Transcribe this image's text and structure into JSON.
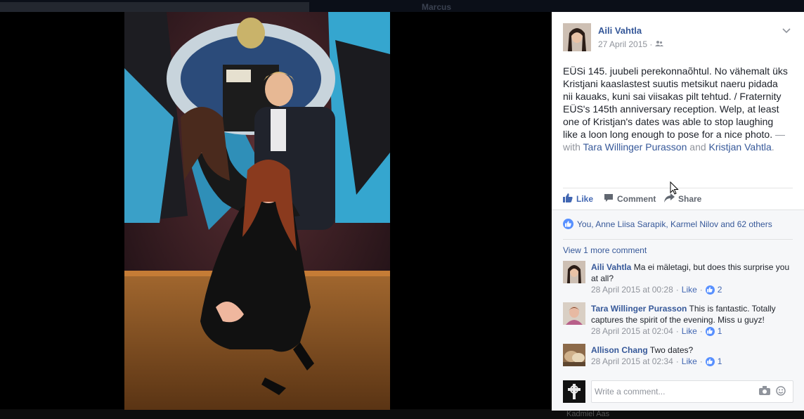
{
  "background": {
    "top_name": "Marcus",
    "bottom_name": "Kadmiel Aas"
  },
  "post": {
    "author": "Aili Vahtla",
    "date": "27 April 2015 ·",
    "audience_icon": "friends-icon",
    "text": "EÜSi 145. juubeli perekonnaõhtul. No vähemalt üks Kristjani kaaslastest suutis metsikut naeru pidada nii kauaks, kuni sai viisakas pilt tehtud. / Fraternity EÜS's 145th anniversary reception. Welp, at least one of Kristjan's dates was able to stop laughing like a loon long enough to pose for a nice photo.",
    "with_prefix": " — with ",
    "tag1": "Tara Willinger Purasson",
    "and": " and ",
    "tag2": "Kristjan Vahtla",
    "period": "."
  },
  "actions": {
    "like": "Like",
    "comment": "Comment",
    "share": "Share"
  },
  "reactions": {
    "summary": "You, Anne Liisa Sarapik, Karmel Nilov and 62 others"
  },
  "comments": {
    "view_more": "View 1 more comment",
    "items": [
      {
        "name": "Aili Vahtla",
        "text": "Ma ei mäletagi, but does this surprise you at all?",
        "time": "28 April 2015 at 00:28",
        "sep": " · ",
        "like": "Like",
        "count": "2"
      },
      {
        "name": "Tara Willinger Purasson",
        "text": "This is fantastic. Totally captures the spirit of the evening. Miss u guyz!",
        "time": "28 April 2015 at 02:04",
        "sep": " · ",
        "like": "Like",
        "count": "1"
      },
      {
        "name": "Allison Chang",
        "text": "Two dates?",
        "time": "28 April 2015 at 02:34",
        "sep": " · ",
        "like": "Like",
        "count": "1"
      }
    ],
    "write_placeholder": "Write a comment..."
  },
  "colors": {
    "link": "#365899",
    "like_blue": "#4267b2",
    "badge_blue": "#5890ff",
    "meta_gray": "#90949c"
  }
}
